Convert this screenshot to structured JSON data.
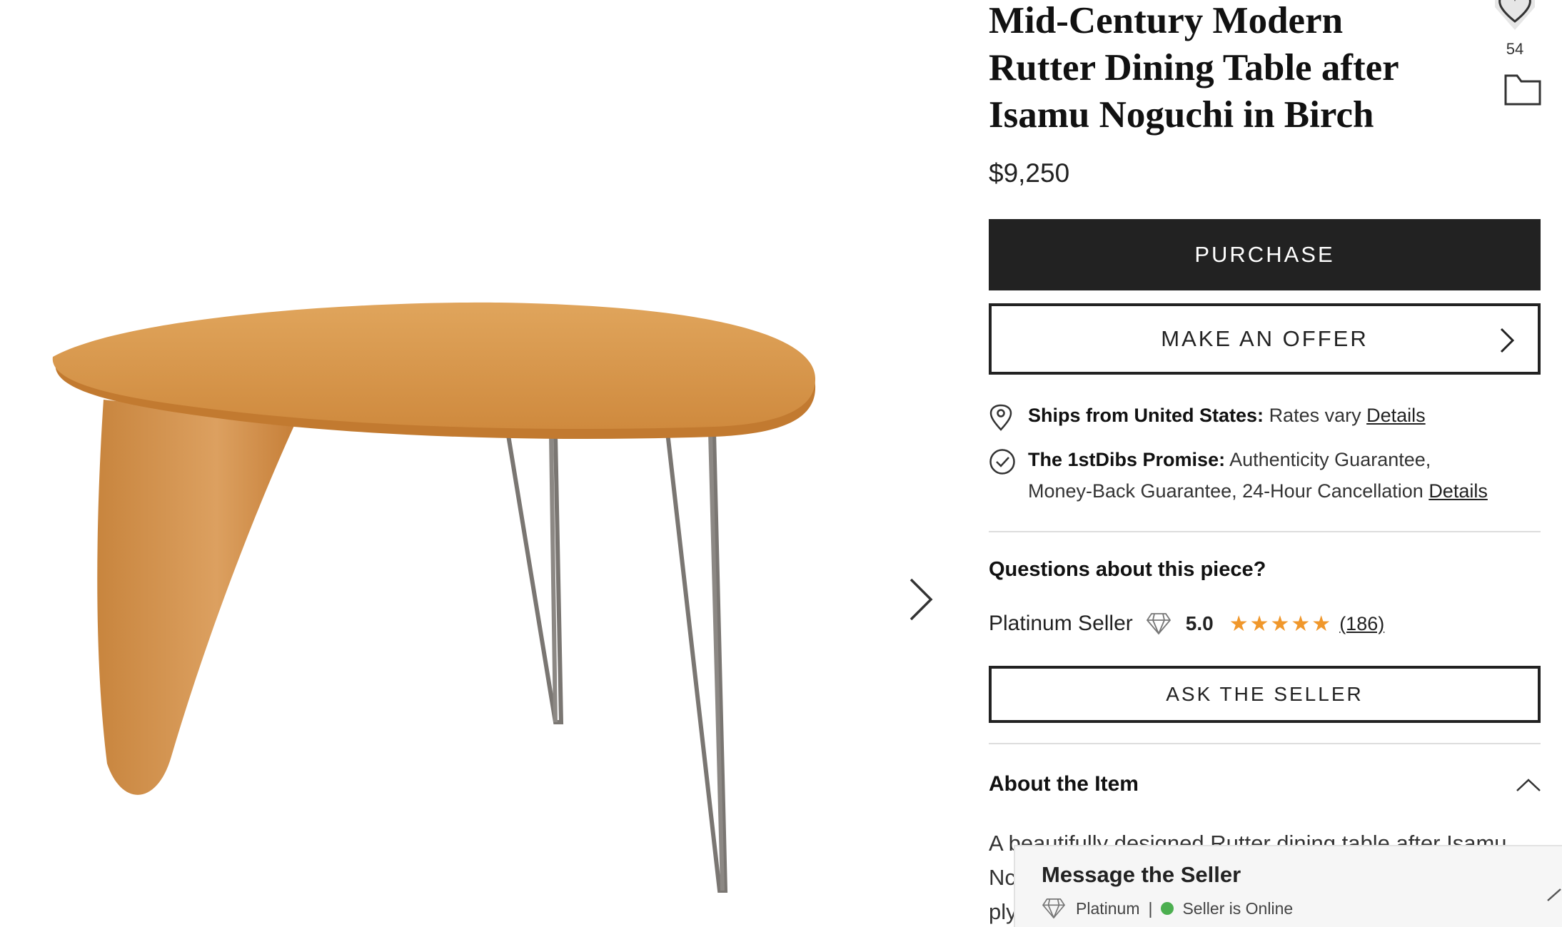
{
  "product": {
    "title_line1": "Mid-Century Modern",
    "title_line2": "Rutter Dining Table after",
    "title_line3": "Isamu Noguchi in Birch",
    "price": "$9,250",
    "favorite_count": "54"
  },
  "actions": {
    "purchase_label": "PURCHASE",
    "offer_label": "MAKE AN OFFER",
    "ask_label": "ASK THE SELLER"
  },
  "shipping": {
    "label": "Ships from United States:",
    "text": "Rates vary",
    "link": "Details"
  },
  "promise": {
    "label": "The 1stDibs Promise:",
    "text_line1": "Authenticity Guarantee,",
    "text_line2": "Money-Back Guarantee, 24-Hour Cancellation",
    "link": "Details"
  },
  "seller": {
    "questions_heading": "Questions about this piece?",
    "tier": "Platinum Seller",
    "rating": "5.0",
    "stars": "★★★★★",
    "stars_filled": 5,
    "reviews": "(186)"
  },
  "about": {
    "heading": "About the Item",
    "line1": "A beautifully designed Rutter dining table after Isamu",
    "line2": "Nc",
    "line3": "ply"
  },
  "message_panel": {
    "title": "Message the Seller",
    "tier": "Platinum",
    "separator": "|",
    "status": "Seller is Online"
  },
  "colors": {
    "primary_button": "#222222",
    "star": "#f0972b",
    "online": "#4caf50",
    "wood": "#d99a4e"
  },
  "icons": {
    "next": "chevron-right-icon",
    "favorite": "heart-icon",
    "folder": "folder-icon",
    "shipping": "location-pin-icon",
    "promise": "check-circle-icon",
    "diamond": "diamond-icon",
    "collapse": "chevron-up-icon"
  }
}
